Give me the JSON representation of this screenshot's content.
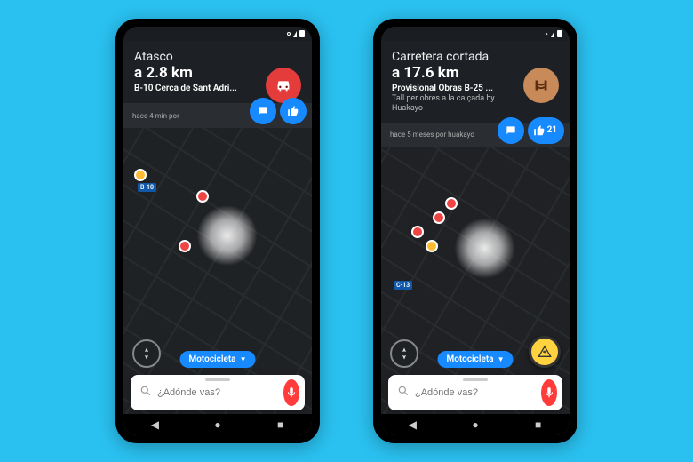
{
  "phones": [
    {
      "alert": {
        "title": "Atasco",
        "distance": "a 2.8 km",
        "road": "B-10 Cerca de Sant Adri...",
        "subtitle": "",
        "type": "traffic"
      },
      "meta": {
        "time": "hace 4 min por",
        "like_count": ""
      },
      "map": {
        "shields": [
          "B-10"
        ],
        "pois": 5
      },
      "vehicle_label": "Motocicleta",
      "search_placeholder": "¿Adónde vas?",
      "show_report_fab": false
    },
    {
      "alert": {
        "title": "Carretera cortada",
        "distance": "a 17.6 km",
        "road": "Provisional Obras  B-25 ...",
        "subtitle": "Tall per obres a la calçada by Huakayo",
        "type": "closure"
      },
      "meta": {
        "time": "hace 5 meses por huakayo",
        "like_count": "21"
      },
      "map": {
        "shields": [
          "C-13"
        ],
        "pois": 7
      },
      "vehicle_label": "Motocicleta",
      "search_placeholder": "¿Adónde vas?",
      "show_report_fab": true
    }
  ]
}
